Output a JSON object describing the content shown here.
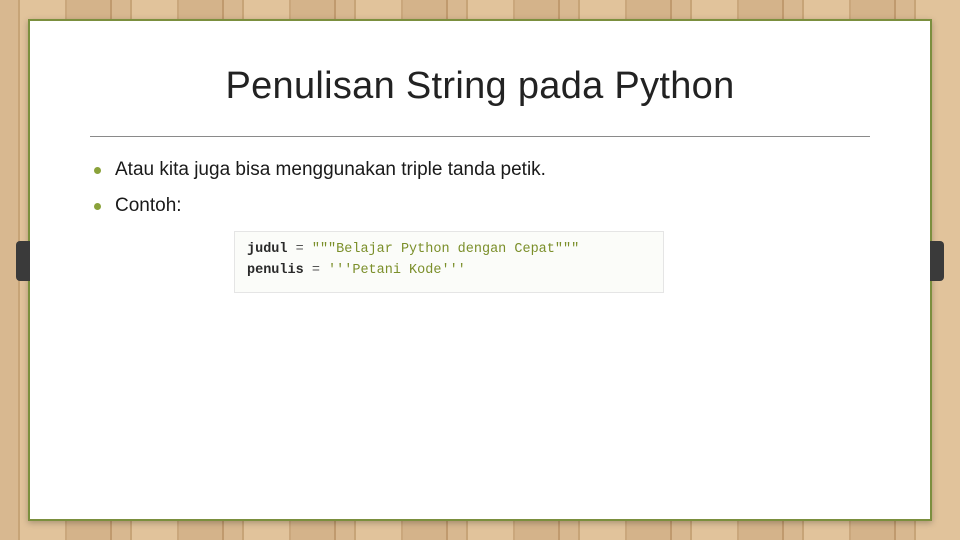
{
  "title": "Penulisan String pada Python",
  "bullets": [
    "Atau kita juga bisa menggunakan triple tanda petik.",
    "Contoh:"
  ],
  "code": {
    "line1": {
      "var": "judul",
      "op": "=",
      "str": "\"\"\"Belajar Python dengan Cepat\"\"\""
    },
    "line2": {
      "var": "penulis",
      "op": "=",
      "str": "'''Petani Kode'''"
    }
  }
}
